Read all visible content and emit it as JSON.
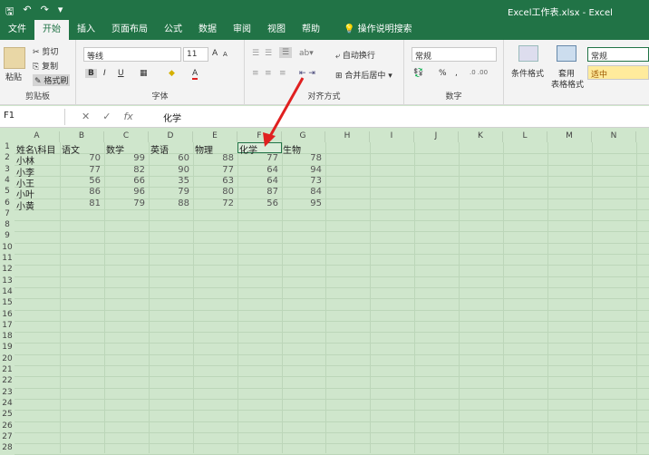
{
  "title": "Excel工作表.xlsx - Excel",
  "qat": {
    "save": "🖫",
    "undo": "↶",
    "redo": "↷",
    "more": "▾"
  },
  "tabs": [
    "文件",
    "开始",
    "插入",
    "页面布局",
    "公式",
    "数据",
    "审阅",
    "视图",
    "帮助"
  ],
  "active_tab": "开始",
  "tell_me": "操作说明搜索",
  "ribbon": {
    "clipboard": {
      "label": "剪贴板",
      "paste": "粘贴",
      "cut": "剪切",
      "copy": "复制",
      "format_painter": "格式刷"
    },
    "font": {
      "label": "字体",
      "font_name": "等线",
      "font_size": "11",
      "bold": "B",
      "italic": "I",
      "underline": "U",
      "grow": "A",
      "shrink": "A",
      "font_color": "A"
    },
    "alignment": {
      "label": "对齐方式",
      "wrap": "自动换行",
      "merge": "合并后居中"
    },
    "number": {
      "label": "数字",
      "format": "常规",
      "percent": "%",
      "comma": ","
    },
    "styles": {
      "conditional": "条件格式",
      "table": "套用",
      "table2": "表格格式",
      "style1": "常规",
      "style2": "适中"
    }
  },
  "formula_bar": {
    "name_box": "F1",
    "fx": "fx",
    "value": "化学"
  },
  "columns": [
    "A",
    "B",
    "C",
    "D",
    "E",
    "F",
    "G",
    "H",
    "I",
    "J",
    "K",
    "L",
    "M",
    "N"
  ],
  "headers": [
    "姓名\\科目",
    "语文",
    "数学",
    "英语",
    "物理",
    "化学",
    "生物"
  ],
  "rows": [
    {
      "name": "小林",
      "values": [
        "70",
        "99",
        "60",
        "88",
        "77",
        "78"
      ]
    },
    {
      "name": "小李",
      "values": [
        "77",
        "82",
        "90",
        "77",
        "64",
        "94"
      ]
    },
    {
      "name": "小王",
      "values": [
        "56",
        "66",
        "35",
        "63",
        "64",
        "73"
      ]
    },
    {
      "name": "小叶",
      "values": [
        "86",
        "96",
        "79",
        "80",
        "87",
        "84"
      ]
    },
    {
      "name": "小黄",
      "values": [
        "81",
        "79",
        "88",
        "72",
        "56",
        "95"
      ]
    }
  ],
  "row_numbers": [
    "1",
    "2",
    "3",
    "4",
    "5",
    "6",
    "7",
    "8",
    "9",
    "10",
    "11",
    "12",
    "13",
    "14",
    "15",
    "16",
    "17",
    "18",
    "19",
    "20",
    "21",
    "22",
    "23",
    "24",
    "25",
    "26",
    "27",
    "28"
  ]
}
